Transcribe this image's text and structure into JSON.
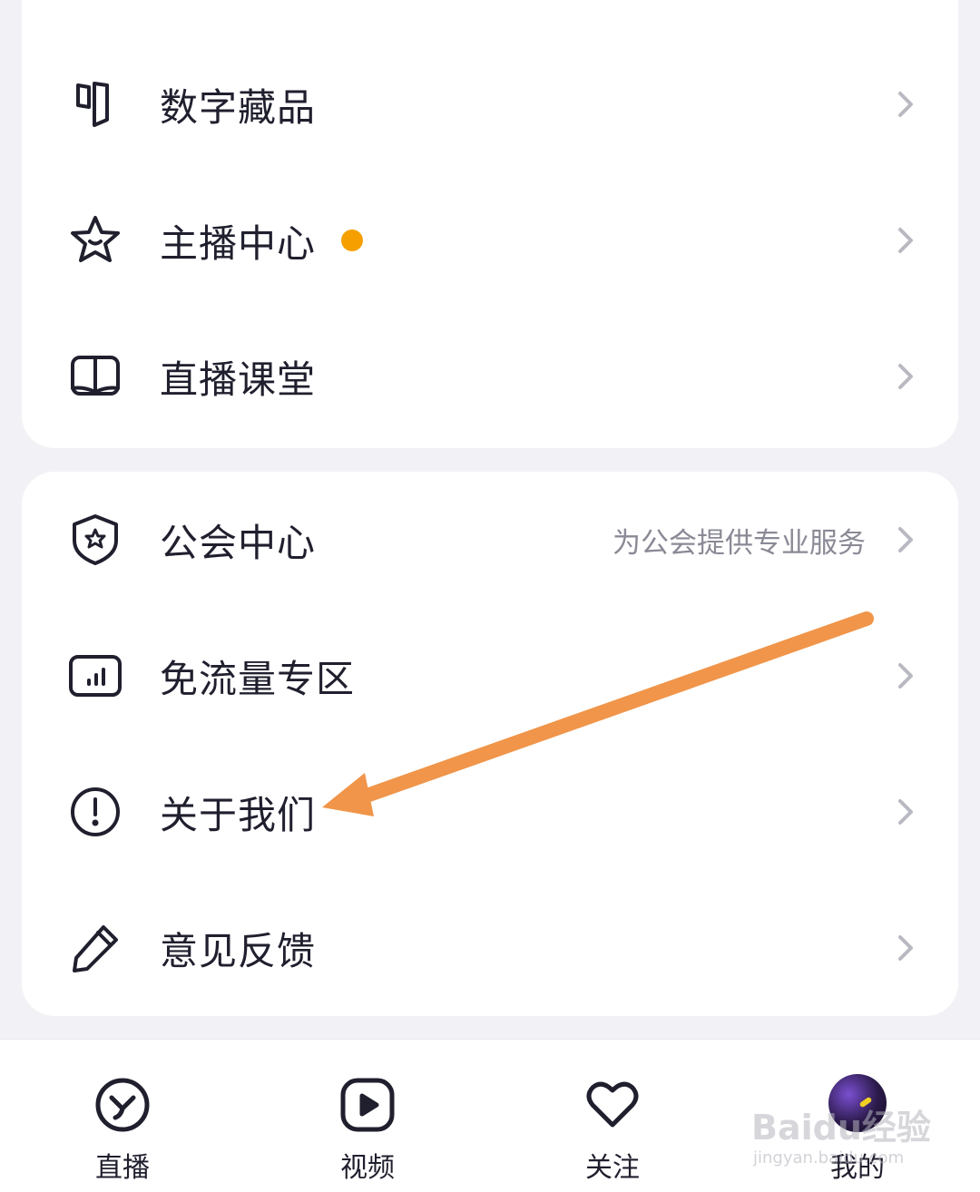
{
  "colors": {
    "accent_dot": "#f5a000",
    "arrow": "#f0954a",
    "chevron": "#b9b9c2",
    "icon_stroke": "#1f1f2e",
    "subtext": "#8a8a96"
  },
  "menu_group_1": {
    "items": [
      {
        "label": "数字藏品",
        "icon": "digital-collectible-icon"
      },
      {
        "label": "主播中心",
        "icon": "star-icon",
        "badge": "dot"
      },
      {
        "label": "直播课堂",
        "icon": "book-icon"
      }
    ]
  },
  "menu_group_2": {
    "items": [
      {
        "label": "公会中心",
        "icon": "shield-star-icon",
        "subtext": "为公会提供专业服务"
      },
      {
        "label": "免流量专区",
        "icon": "signal-bars-icon"
      },
      {
        "label": "关于我们",
        "icon": "info-circle-icon"
      },
      {
        "label": "意见反馈",
        "icon": "pencil-icon"
      }
    ]
  },
  "annotation": {
    "type": "arrow",
    "points_to": "关于我们"
  },
  "tabbar": {
    "tabs": [
      {
        "label": "直播",
        "icon": "live-icon"
      },
      {
        "label": "视频",
        "icon": "video-play-icon"
      },
      {
        "label": "关注",
        "icon": "heart-icon"
      },
      {
        "label": "我的",
        "icon": "avatar"
      }
    ]
  },
  "watermark": {
    "text": "Baidu经验",
    "sub": "jingyan.baidu.com"
  }
}
